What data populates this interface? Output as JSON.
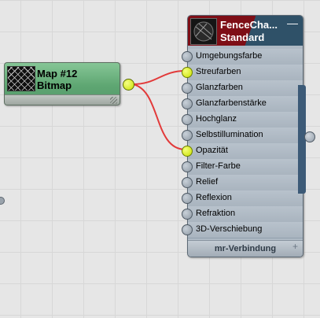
{
  "bitmap_node": {
    "title_line1": "Map #12",
    "title_line2": "Bitmap",
    "thumbnail_icon": "chainlink-fence-icon"
  },
  "material_node": {
    "title_line1": "FenceCha...",
    "title_line2": "Standard",
    "minimize_glyph": "—",
    "thumbnail_icon": "fence-sphere-icon",
    "slots": [
      {
        "label": "Umgebungsfarbe",
        "connected": false
      },
      {
        "label": "Streufarben",
        "connected": true
      },
      {
        "label": "Glanzfarben",
        "connected": false
      },
      {
        "label": "Glanzfarbenstärke",
        "connected": false
      },
      {
        "label": "Hochglanz",
        "connected": false
      },
      {
        "label": "Selbstillumination",
        "connected": false
      },
      {
        "label": "Opazität",
        "connected": true
      },
      {
        "label": "Filter-Farbe",
        "connected": false
      },
      {
        "label": "Relief",
        "connected": false
      },
      {
        "label": "Reflexion",
        "connected": false
      },
      {
        "label": "Refraktion",
        "connected": false
      },
      {
        "label": "3D-Verschiebung",
        "connected": false
      }
    ],
    "footer_label": "mr-Verbindung",
    "footer_plus": "+"
  },
  "colors": {
    "bitmap_node_green": "#5ea672",
    "material_header_red": "#7e0e16",
    "material_header_blue": "#2f5168",
    "wire_red": "#e23a3a",
    "connected_socket": "#c9e000"
  }
}
